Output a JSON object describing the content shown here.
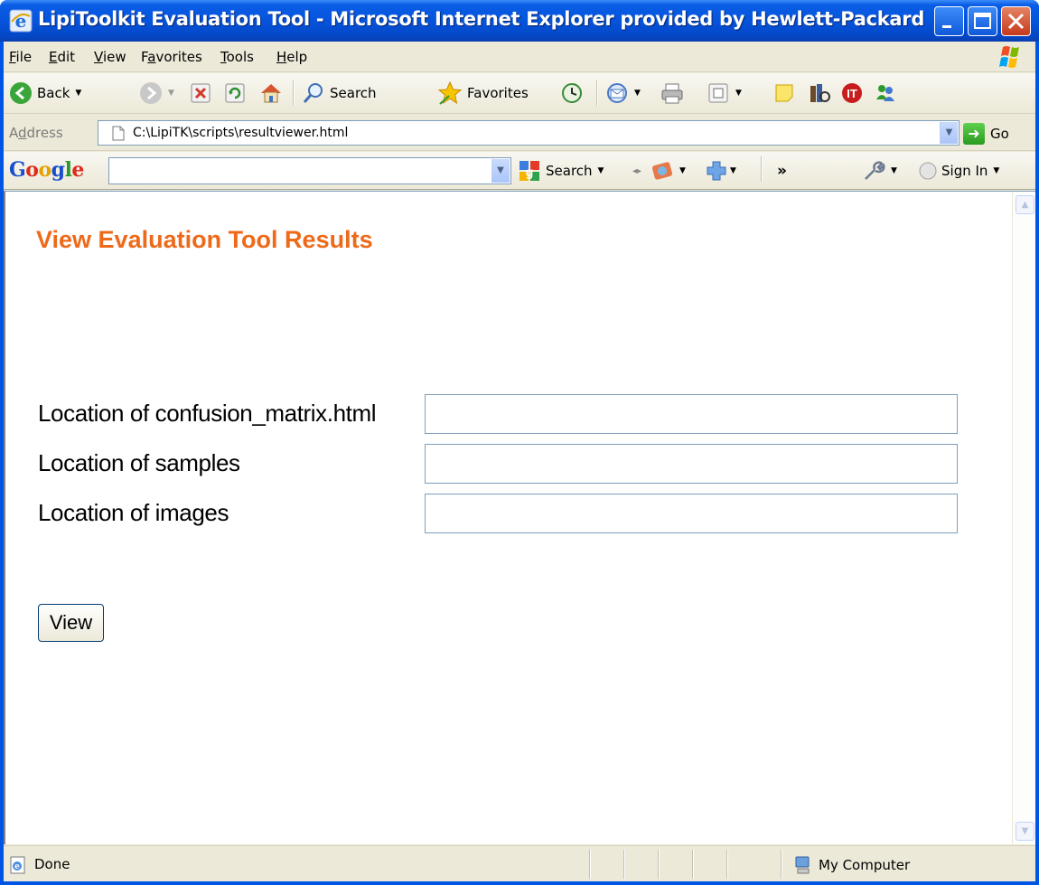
{
  "window": {
    "title": "LipiToolkit Evaluation Tool - Microsoft Internet Explorer provided by Hewlett-Packard"
  },
  "menu": {
    "items": [
      {
        "label": "File",
        "accel": "F",
        "rest": "ile"
      },
      {
        "label": "Edit",
        "accel": "E",
        "rest": "dit"
      },
      {
        "label": "View",
        "accel": "V",
        "rest": "iew"
      },
      {
        "label": "Favorites",
        "pre": "F",
        "accel": "a",
        "rest": "vorites"
      },
      {
        "label": "Tools",
        "accel": "T",
        "rest": "ools"
      },
      {
        "label": "Help",
        "accel": "H",
        "rest": "elp"
      }
    ]
  },
  "toolbar": {
    "back_label": "Back",
    "search_label": "Search",
    "favorites_label": "Favorites"
  },
  "address": {
    "label": "Address",
    "accel": "d",
    "value": "C:\\LipiTK\\scripts\\resultviewer.html",
    "go_label": "Go"
  },
  "google": {
    "search_value": "",
    "search_label": "Search",
    "signin_label": "Sign In",
    "more_label": "»"
  },
  "page": {
    "title": "View Evaluation Tool Results",
    "fields": [
      {
        "label": "Location of confusion_matrix.html",
        "value": ""
      },
      {
        "label": "Location of samples",
        "value": ""
      },
      {
        "label": "Location of images",
        "value": ""
      }
    ],
    "view_button": "View"
  },
  "status": {
    "text": "Done",
    "zone": "My Computer"
  },
  "colors": {
    "title_orange": "#ee6a1a",
    "xp_blue": "#0654dc"
  }
}
